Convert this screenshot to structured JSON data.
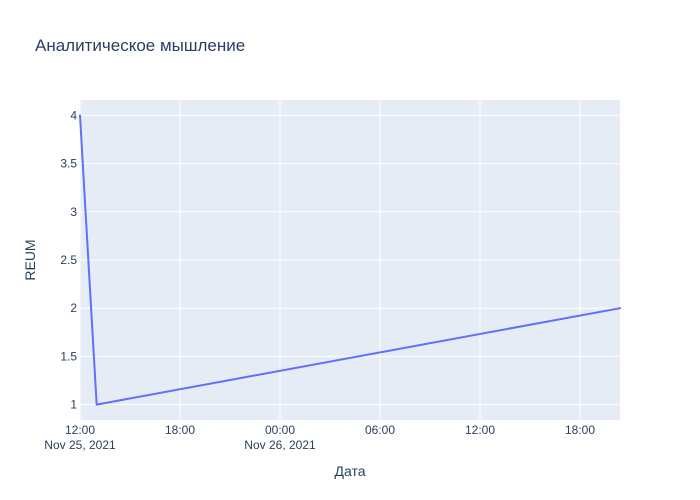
{
  "chart_data": {
    "type": "line",
    "title": "Аналитическое мышление",
    "xlabel": "Дата",
    "ylabel": "REUM",
    "x_tick_labels": [
      {
        "at": "2021-11-25T12:00:00",
        "line1": "12:00",
        "line2": "Nov 25, 2021"
      },
      {
        "at": "2021-11-25T18:00:00",
        "line1": "18:00",
        "line2": ""
      },
      {
        "at": "2021-11-26T00:00:00",
        "line1": "00:00",
        "line2": "Nov 26, 2021"
      },
      {
        "at": "2021-11-26T06:00:00",
        "line1": "06:00",
        "line2": ""
      },
      {
        "at": "2021-11-26T12:00:00",
        "line1": "12:00",
        "line2": ""
      },
      {
        "at": "2021-11-26T18:00:00",
        "line1": "18:00",
        "line2": ""
      }
    ],
    "y_ticks": [
      1,
      1.5,
      2,
      2.5,
      3,
      3.5,
      4
    ],
    "y_tick_labels": [
      "1",
      "1.5",
      "2",
      "2.5",
      "3",
      "3.5",
      "4"
    ],
    "xlim": [
      "2021-11-25T12:00:00",
      "2021-11-26T20:24:00"
    ],
    "ylim": [
      0.84,
      4.16
    ],
    "grid": true,
    "series": [
      {
        "color": "#636efa",
        "points": [
          {
            "x": "2021-11-25T12:00:00",
            "y": 4
          },
          {
            "x": "2021-11-25T13:00:00",
            "y": 1
          },
          {
            "x": "2021-11-26T20:24:00",
            "y": 2
          }
        ]
      }
    ],
    "colors": {
      "plot_bg": "#e5ecf6",
      "grid": "#ffffff",
      "text": "#2a3f5f"
    }
  }
}
